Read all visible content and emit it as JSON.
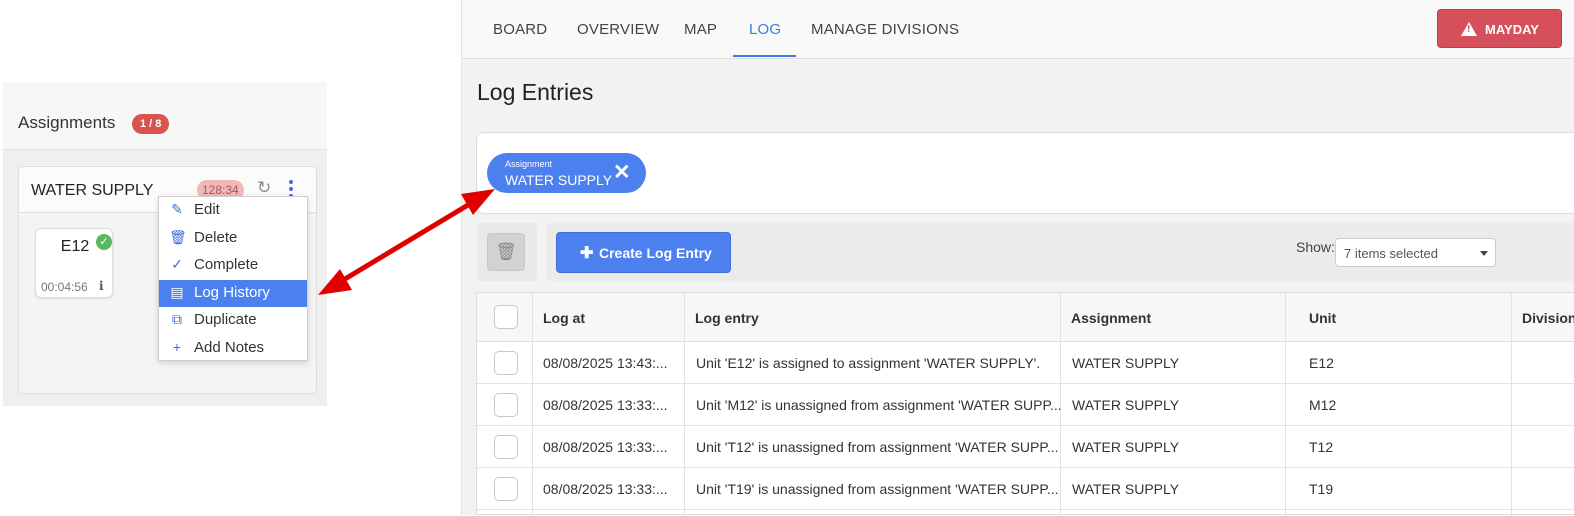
{
  "assignments_panel": {
    "title": "Assignments",
    "count_badge": "1 / 8",
    "card": {
      "title": "WATER SUPPLY",
      "timer": "128:34",
      "unit": {
        "name": "E12",
        "elapsed": "00:04:56"
      }
    },
    "context_menu": [
      {
        "icon": "pencil-icon",
        "label": "Edit",
        "glyph": "✎"
      },
      {
        "icon": "trash-icon",
        "label": "Delete",
        "glyph": "🗑"
      },
      {
        "icon": "check-icon",
        "label": "Complete",
        "glyph": "✓"
      },
      {
        "icon": "document-icon",
        "label": "Log History",
        "glyph": "▤",
        "active": true
      },
      {
        "icon": "copy-icon",
        "label": "Duplicate",
        "glyph": "⧉"
      },
      {
        "icon": "plus-icon",
        "label": "Add Notes",
        "glyph": "+"
      }
    ]
  },
  "nav": {
    "tabs": [
      {
        "label": "BOARD"
      },
      {
        "label": "OVERVIEW"
      },
      {
        "label": "MAP"
      },
      {
        "label": "LOG",
        "active": true
      },
      {
        "label": "MANAGE DIVISIONS"
      }
    ],
    "mayday_label": "MAYDAY"
  },
  "log": {
    "title": "Log Entries",
    "filter_chip": {
      "label": "Assignment",
      "value": "WATER SUPPLY"
    },
    "create_label": "Create Log Entry",
    "show_label": "Show:",
    "show_value": "7 items selected",
    "columns": [
      "Log at",
      "Log entry",
      "Assignment",
      "Unit",
      "Division"
    ],
    "rows": [
      {
        "log_at": "08/08/2025 13:43:...",
        "entry": "Unit 'E12' is assigned to assignment 'WATER SUPPLY'.",
        "assignment": "WATER SUPPLY",
        "unit": "E12"
      },
      {
        "log_at": "08/08/2025 13:33:...",
        "entry": "Unit 'M12' is unassigned from assignment 'WATER SUPP...",
        "assignment": "WATER SUPPLY",
        "unit": "M12"
      },
      {
        "log_at": "08/08/2025 13:33:...",
        "entry": "Unit 'T12' is unassigned from assignment 'WATER SUPP...",
        "assignment": "WATER SUPPLY",
        "unit": "T12"
      },
      {
        "log_at": "08/08/2025 13:33:...",
        "entry": "Unit 'T19' is unassigned from assignment 'WATER SUPP...",
        "assignment": "WATER SUPPLY",
        "unit": "T19"
      }
    ]
  },
  "colors": {
    "accent": "#4d80ef",
    "danger": "#d5505a",
    "annotation_arrow": "#e00000"
  }
}
